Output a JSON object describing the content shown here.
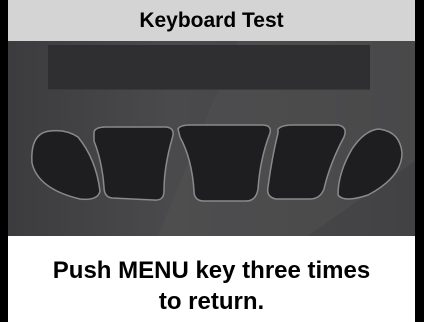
{
  "title": "Keyboard Test",
  "keypad": {
    "keys": [
      {
        "name": "key-1-icon"
      },
      {
        "name": "key-2-icon"
      },
      {
        "name": "key-3-icon"
      },
      {
        "name": "key-4-icon"
      },
      {
        "name": "key-5-icon"
      }
    ]
  },
  "message": {
    "line1": "Push MENU key three times",
    "line2": "to return."
  },
  "colors": {
    "title_bar": "#d4d4d4",
    "panel": "#444446",
    "key_fill": "#1e1e20",
    "key_edge": "#8a8a8c",
    "frame": "#000000",
    "text": "#000000"
  }
}
